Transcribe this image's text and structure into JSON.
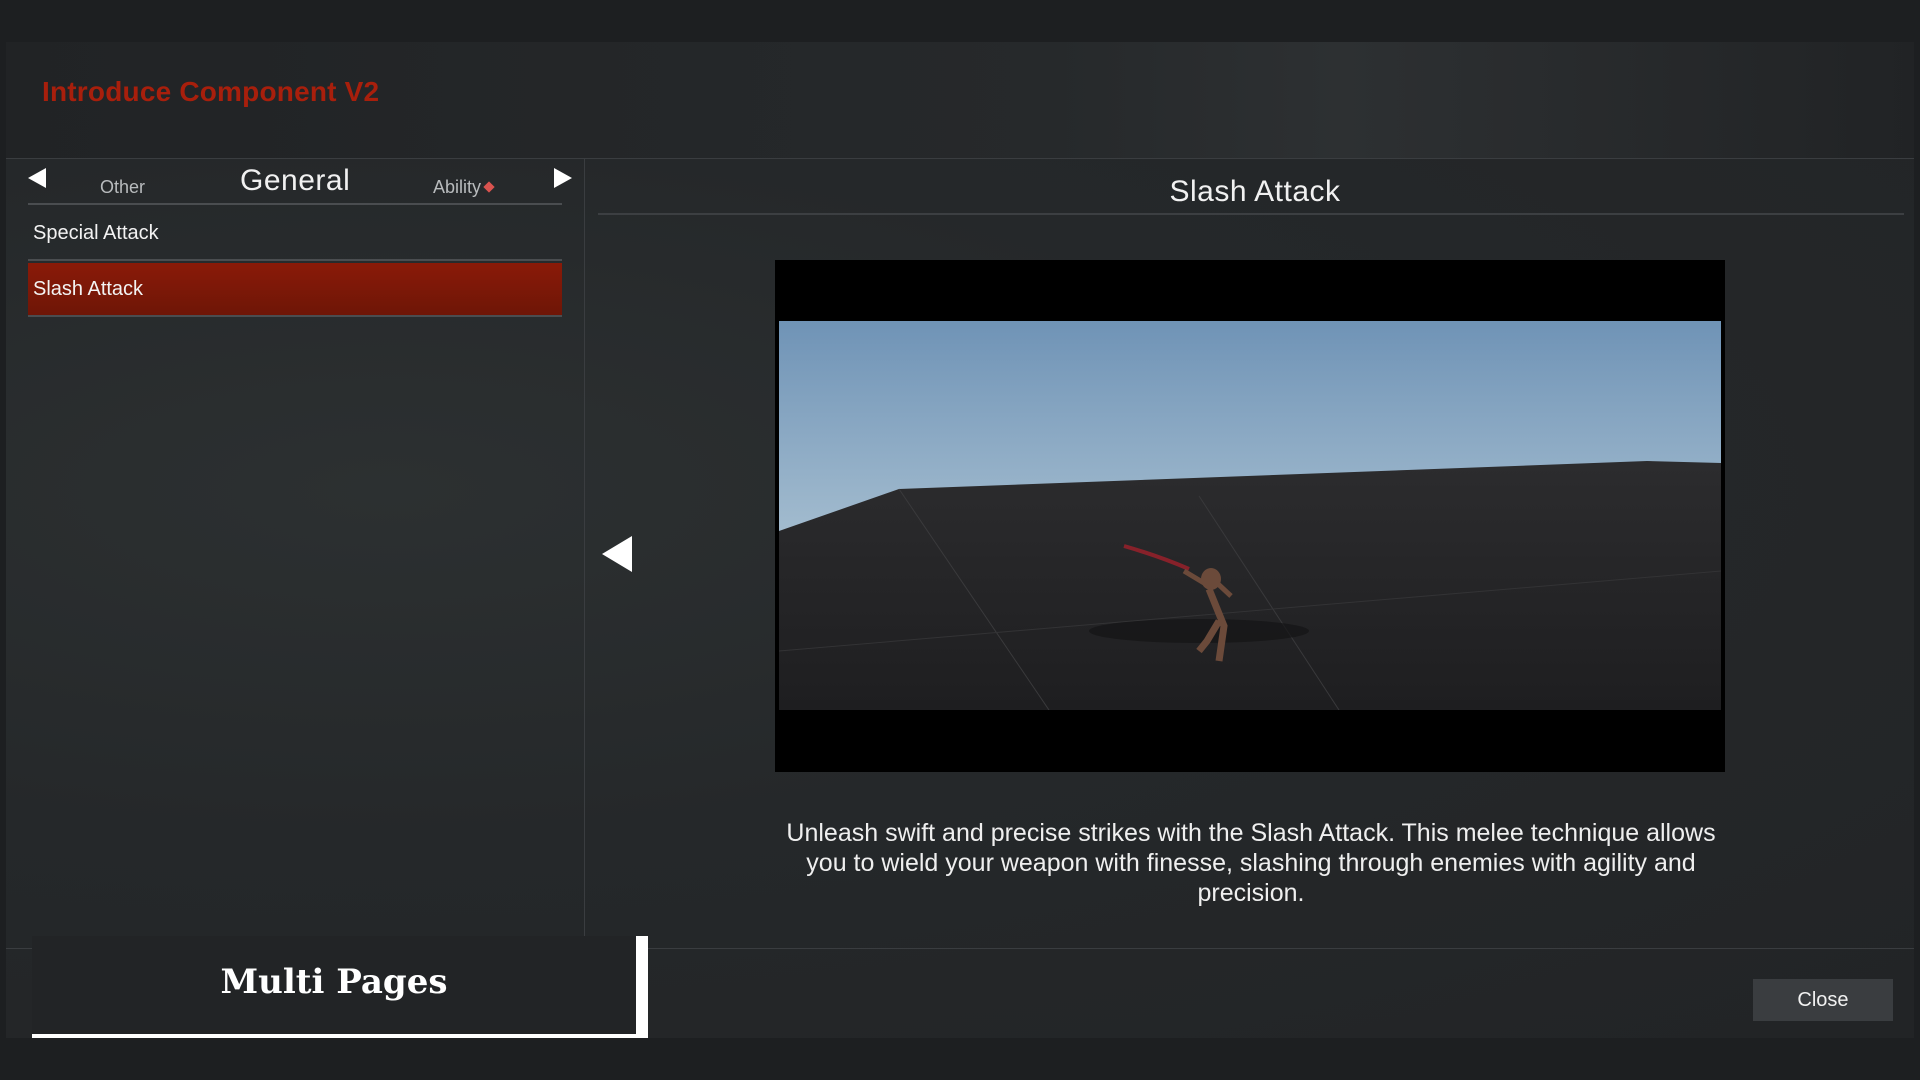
{
  "window": {
    "title": "Introduce Component V2"
  },
  "category_nav": {
    "previous": "Other",
    "current": "General",
    "next": "Ability"
  },
  "list": {
    "items": [
      {
        "label": "Special Attack",
        "selected": false
      },
      {
        "label": "Slash Attack",
        "selected": true
      }
    ]
  },
  "detail": {
    "title": "Slash Attack",
    "description": "Unleash swift and precise strikes with the Slash Attack. This melee technique allows you to wield your weapon with finesse, slashing through enemies with agility and precision."
  },
  "footer": {
    "badge_label": "Multi Pages",
    "close_label": "Close"
  },
  "colors": {
    "accent": "#a81f0c",
    "selected_row": "#8a1a08",
    "background": "#1d1f21"
  },
  "icons": {
    "prev_category": "triangle-left-icon",
    "next_category": "triangle-right-icon",
    "ability_marker": "diamond-icon",
    "prev_page": "triangle-left-icon"
  }
}
